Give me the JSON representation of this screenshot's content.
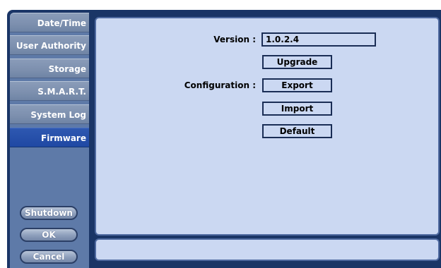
{
  "sidebar": {
    "items": [
      {
        "label": "Date/Time",
        "active": false
      },
      {
        "label": "User Authority",
        "active": false
      },
      {
        "label": "Storage",
        "active": false
      },
      {
        "label": "S.M.A.R.T.",
        "active": false
      },
      {
        "label": "System Log",
        "active": false
      },
      {
        "label": "Firmware",
        "active": true
      }
    ],
    "buttons": {
      "shutdown": "Shutdown",
      "ok": "OK",
      "cancel": "Cancel"
    }
  },
  "main": {
    "version_label": "Version :",
    "version_value": "1.0.2.4",
    "upgrade_label": "Upgrade",
    "configuration_label": "Configuration :",
    "export_label": "Export",
    "import_label": "Import",
    "default_label": "Default"
  },
  "status": {
    "text": ""
  },
  "colors": {
    "frame": "#1a3566",
    "active_item": "#2453ad",
    "panel": "#cbd8f2"
  }
}
